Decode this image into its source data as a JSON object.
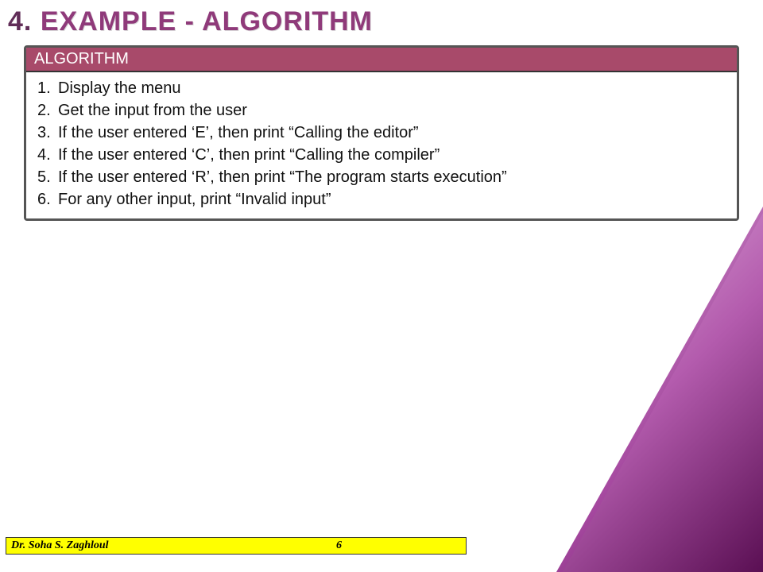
{
  "title": {
    "number": "4.",
    "text": "Example - Algorithm"
  },
  "box": {
    "header": "ALGORITHM",
    "items": [
      {
        "n": "1.",
        "t": "Display the menu"
      },
      {
        "n": "2.",
        "t": "Get the input from the user"
      },
      {
        "n": "3.",
        "t": "If the user entered ‘E’, then print “Calling the editor”"
      },
      {
        "n": "4.",
        "t": "If the user entered ‘C’, then print “Calling the compiler”"
      },
      {
        "n": "5.",
        "t": "If the user entered ‘R’, then print “The program starts execution”"
      },
      {
        "n": "6.",
        "t": "For any other input, print “Invalid input”"
      }
    ]
  },
  "footer": {
    "author": "Dr. Soha S. Zaghloul",
    "page": "6"
  }
}
